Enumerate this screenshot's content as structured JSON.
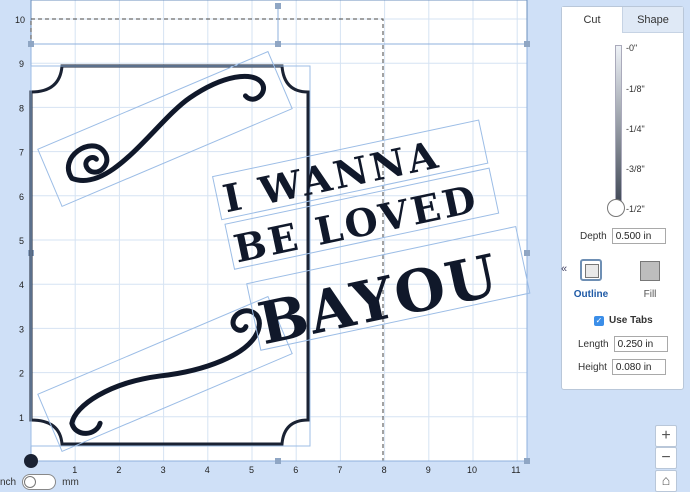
{
  "ruler": {
    "y_labels": [
      "10",
      "9",
      "8",
      "7",
      "6",
      "5",
      "4",
      "3",
      "2",
      "1"
    ],
    "x_labels": [
      "1",
      "2",
      "3",
      "4",
      "5",
      "6",
      "7",
      "8",
      "9",
      "10",
      "11"
    ]
  },
  "artwork": {
    "line1": "I WANNA",
    "line2": "BE LOVED",
    "line3": "BAYOU"
  },
  "panel": {
    "tabs": [
      {
        "label": "Cut",
        "active": true
      },
      {
        "label": "Shape",
        "active": false
      }
    ],
    "depth_scale": [
      "-0\"",
      "-1/8\"",
      "-1/4\"",
      "-3/8\"",
      "-1/2\""
    ],
    "depth_label": "Depth",
    "depth_value": "0.500 in",
    "collapse_glyph": "«",
    "outline_label": "Outline",
    "fill_label": "Fill",
    "use_tabs_label": "Use Tabs",
    "use_tabs_checked": true,
    "length_label": "Length",
    "length_value": "0.250 in",
    "height_label": "Height",
    "height_value": "0.080 in"
  },
  "zoom": {
    "plus": "+",
    "minus": "−",
    "home": "⌂"
  },
  "units": {
    "left": "nch",
    "right": "mm"
  },
  "colors": {
    "accent": "#3b8ee8",
    "selection": "#7aa7e0",
    "workspace": "#cfe0f7"
  }
}
